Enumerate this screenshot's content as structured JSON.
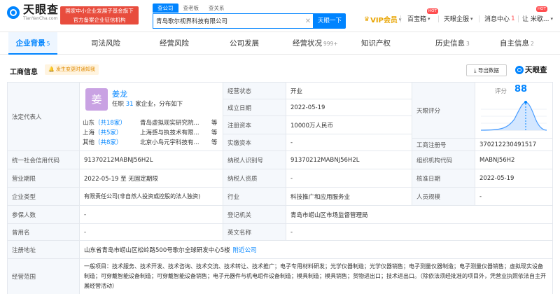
{
  "header": {
    "logo_cn": "天眼查",
    "logo_en": "TianYanCha.com",
    "badge_line1": "国家中小企业发展子基金旗下",
    "badge_line2": "官方备案企业征信机构",
    "search_tabs": [
      "查公司",
      "查老板",
      "查关系"
    ],
    "search_value": "青岛歌尔视界科技有限公司",
    "search_button": "天眼一下",
    "vip": "VIP会员",
    "toolbox": "百宝箱",
    "hot": "HOT",
    "enterprise": "天眼企服",
    "messages": "消息中心",
    "message_count": "1",
    "user": "让 米歇..."
  },
  "tabs": [
    {
      "label": "企业背景",
      "count": "5"
    },
    {
      "label": "司法风险",
      "count": ""
    },
    {
      "label": "经营风险",
      "count": ""
    },
    {
      "label": "公司发展",
      "count": ""
    },
    {
      "label": "经营状况",
      "count": "999+"
    },
    {
      "label": "知识产权",
      "count": ""
    },
    {
      "label": "历史信息",
      "count": "3"
    },
    {
      "label": "自主信息",
      "count": "2"
    }
  ],
  "section": {
    "title": "工商信息",
    "change_tag": "发生变更时通知我",
    "export": "导出数据",
    "brand": "天眼查"
  },
  "rep": {
    "label": "法定代表人",
    "avatar": "姜",
    "name": "姜龙",
    "sub_prefix": "任职",
    "sub_count": "31",
    "sub_suffix": "家企业，分布如下",
    "rows": [
      {
        "prov": "山东",
        "count": "（共18家）",
        "company": "青岛虚拟现实研究院...",
        "etc": "等"
      },
      {
        "prov": "上海",
        "count": "（共5家）",
        "company": "上海感与执技术有限...",
        "etc": "等"
      },
      {
        "prov": "其他",
        "count": "（共8家）",
        "company": "北京小鸟元宇科技有...",
        "etc": "等"
      }
    ]
  },
  "fields": {
    "status_label": "经营状态",
    "status": "开业",
    "founded_label": "成立日期",
    "founded": "2022-05-19",
    "capital_label": "注册资本",
    "capital": "10000万人民币",
    "paid_label": "实缴资本",
    "paid": "-",
    "score_label": "天眼评分",
    "score": "88",
    "score_text": "评分",
    "reg_no_label": "工商注册号",
    "reg_no": "370212230491517",
    "credit_label": "统一社会信用代码",
    "credit": "91370212MABNJ56H2L",
    "tax_label": "纳税人识别号",
    "tax": "91370212MABNJ56H2L",
    "org_label": "组织机构代码",
    "org": "MABNJ56H2",
    "term_label": "营业期限",
    "term": "2022-05-19  至 无固定期限",
    "taxq_label": "纳税人资质",
    "taxq": "-",
    "approve_label": "核准日期",
    "approve": "2022-05-19",
    "type_label": "企业类型",
    "type": "有限责任公司(非自然人投资或控股的法人独资)",
    "industry_label": "行业",
    "industry": "科技推广和应用服务业",
    "staff_label": "人员规模",
    "staff": "-",
    "insured_label": "参保人数",
    "insured": "-",
    "authority_label": "登记机关",
    "authority": "青岛市崂山区市场监督管理局",
    "former_label": "曾用名",
    "former": "-",
    "en_label": "英文名称",
    "en": "-",
    "addr_label": "注册地址",
    "addr": "山东省青岛市崂山区松岭路500号歌尔全球研发中心5楼",
    "addr_link": "附近公司",
    "scope_label": "经营范围",
    "scope": "一般项目：技术服务、技术开发、技术咨询、技术交流、技术转让、技术推广；电子专用材料研发；光学仪器制造；光学仪器销售；电子测量仪器制造；电子测量仪器销售；虚拟现实设备制造；可穿戴智能设备制造；可穿戴智能设备销售；电子元器件与机电组件设备制造；模具制造；模具销售；货物进出口；技术进出口。（除依法须经批准的项目外，凭营业执照依法自主开展经营活动）"
  },
  "colors": {
    "accent": "#0084ff",
    "badge": "#e84c3d",
    "vip": "#e8a400"
  }
}
